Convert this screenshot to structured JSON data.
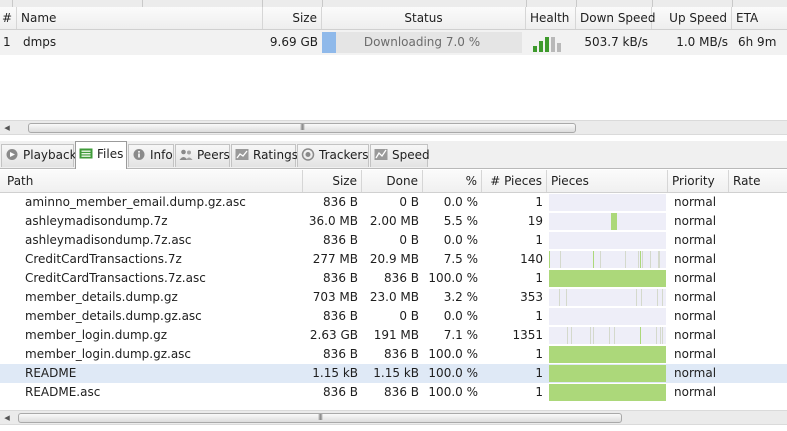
{
  "torrent_list": {
    "headers": {
      "index": "#",
      "name": "Name",
      "size": "Size",
      "status": "Status",
      "health": "Health",
      "down_speed": "Down Speed",
      "up_speed": "Up Speed",
      "eta": "ETA"
    },
    "rows": [
      {
        "index": "1",
        "name": "dmps",
        "size": "9.69 GB",
        "status": "Downloading 7.0 %",
        "progress": 0.07,
        "health_bars": [
          0.35,
          0.6,
          0.85,
          0.85,
          0.5
        ],
        "down_speed": "503.7 kB/s",
        "up_speed": "1.0 MB/s",
        "eta": "6h 9m"
      }
    ]
  },
  "scrollbar_grip": "III",
  "tabs": [
    {
      "label": "Playback",
      "icon": "playback-icon",
      "active": false
    },
    {
      "label": "Files",
      "icon": "files-icon",
      "active": true
    },
    {
      "label": "Info",
      "icon": "info-icon",
      "active": false
    },
    {
      "label": "Peers",
      "icon": "peers-icon",
      "active": false
    },
    {
      "label": "Ratings",
      "icon": "ratings-icon",
      "active": false
    },
    {
      "label": "Trackers",
      "icon": "trackers-icon",
      "active": false
    },
    {
      "label": "Speed",
      "icon": "speed-icon",
      "active": false
    }
  ],
  "files": {
    "headers": {
      "path": "Path",
      "size": "Size",
      "done": "Done",
      "percent": "%",
      "pieces_count": "# Pieces",
      "pieces": "Pieces",
      "priority": "Priority",
      "rate": "Rate"
    },
    "rows": [
      {
        "path": "aminno_member_email.dump.gz.asc",
        "size": "836 B",
        "done": "0 B",
        "percent": "0.0 %",
        "pieces": "1",
        "priority": "normal"
      },
      {
        "path": "ashleymadisondump.7z",
        "size": "36.0 MB",
        "done": "2.00 MB",
        "percent": "5.5 %",
        "pieces": "19",
        "priority": "normal"
      },
      {
        "path": "ashleymadisondump.7z.asc",
        "size": "836 B",
        "done": "0 B",
        "percent": "0.0 %",
        "pieces": "1",
        "priority": "normal"
      },
      {
        "path": "CreditCardTransactions.7z",
        "size": "277 MB",
        "done": "20.9 MB",
        "percent": "7.5 %",
        "pieces": "140",
        "priority": "normal"
      },
      {
        "path": "CreditCardTransactions.7z.asc",
        "size": "836 B",
        "done": "836 B",
        "percent": "100.0 %",
        "pieces": "1",
        "priority": "normal"
      },
      {
        "path": "member_details.dump.gz",
        "size": "703 MB",
        "done": "23.0 MB",
        "percent": "3.2 %",
        "pieces": "353",
        "priority": "normal"
      },
      {
        "path": "member_details.dump.gz.asc",
        "size": "836 B",
        "done": "0 B",
        "percent": "0.0 %",
        "pieces": "1",
        "priority": "normal"
      },
      {
        "path": "member_login.dump.gz",
        "size": "2.63 GB",
        "done": "191 MB",
        "percent": "7.1 %",
        "pieces": "1351",
        "priority": "normal"
      },
      {
        "path": "member_login.dump.gz.asc",
        "size": "836 B",
        "done": "836 B",
        "percent": "100.0 %",
        "pieces": "1",
        "priority": "normal"
      },
      {
        "path": "README",
        "size": "1.15 kB",
        "done": "1.15 kB",
        "percent": "100.0 %",
        "pieces": "1",
        "priority": "normal",
        "selected": true
      },
      {
        "path": "README.asc",
        "size": "836 B",
        "done": "836 B",
        "percent": "100.0 %",
        "pieces": "1",
        "priority": "normal"
      }
    ]
  },
  "colors": {
    "piece_done": "#acd87a",
    "piece_track": "#eeeef8",
    "status_fill": "#8fb9ea",
    "health": "#3e9a2c",
    "selected_row": "#dfe9f6"
  }
}
